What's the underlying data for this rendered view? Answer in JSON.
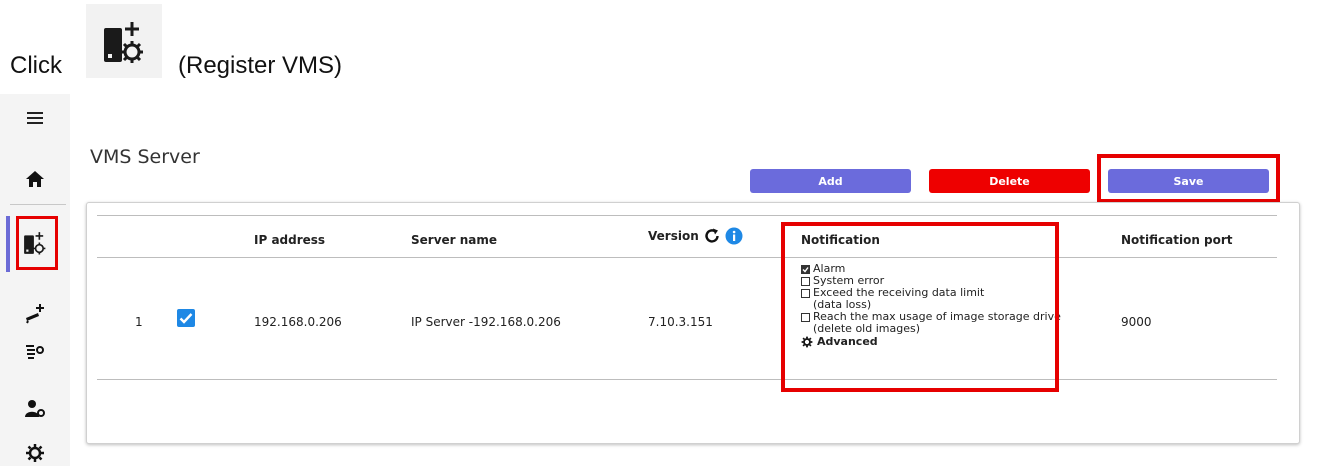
{
  "instruction": {
    "click_word": "Click",
    "action_label": "(Register VMS)",
    "icon": "register-vms-icon"
  },
  "sidebar": {
    "items": [
      {
        "icon": "hamburger-menu-icon"
      },
      {
        "icon": "home-icon"
      },
      {
        "icon": "register-vms-icon",
        "active": true
      },
      {
        "icon": "add-camera-icon"
      },
      {
        "icon": "camera-list-settings-icon"
      },
      {
        "icon": "user-settings-icon"
      },
      {
        "icon": "gear-icon"
      }
    ],
    "active_color": "#6b6bd6"
  },
  "page": {
    "title": "VMS Server"
  },
  "toolbar": {
    "add_label": "Add",
    "delete_label": "Delete",
    "save_label": "Save",
    "add_color": "#6b6bdc",
    "delete_color": "#ee0000",
    "save_color": "#6b6bdc"
  },
  "table": {
    "headers": {
      "ip_address": "IP address",
      "server_name": "Server name",
      "version": "Version",
      "notification": "Notification",
      "notification_port": "Notification port"
    },
    "rows": [
      {
        "index": "1",
        "checked": true,
        "ip_address": "192.168.0.206",
        "server_name": "IP Server -192.168.0.206",
        "version": "7.10.3.151",
        "notification_port": "9000",
        "notifications": {
          "alarm": {
            "label": "Alarm",
            "checked": true
          },
          "system_error": {
            "label": "System error",
            "checked": false
          },
          "data_limit": {
            "label": "Exceed the receiving data limit",
            "sub": "(data loss)",
            "checked": false
          },
          "storage": {
            "label": "Reach the max usage of image storage drive",
            "sub": "(delete old images)",
            "checked": false
          },
          "advanced_label": "Advanced"
        }
      }
    ]
  },
  "highlight_color": "#e60000"
}
